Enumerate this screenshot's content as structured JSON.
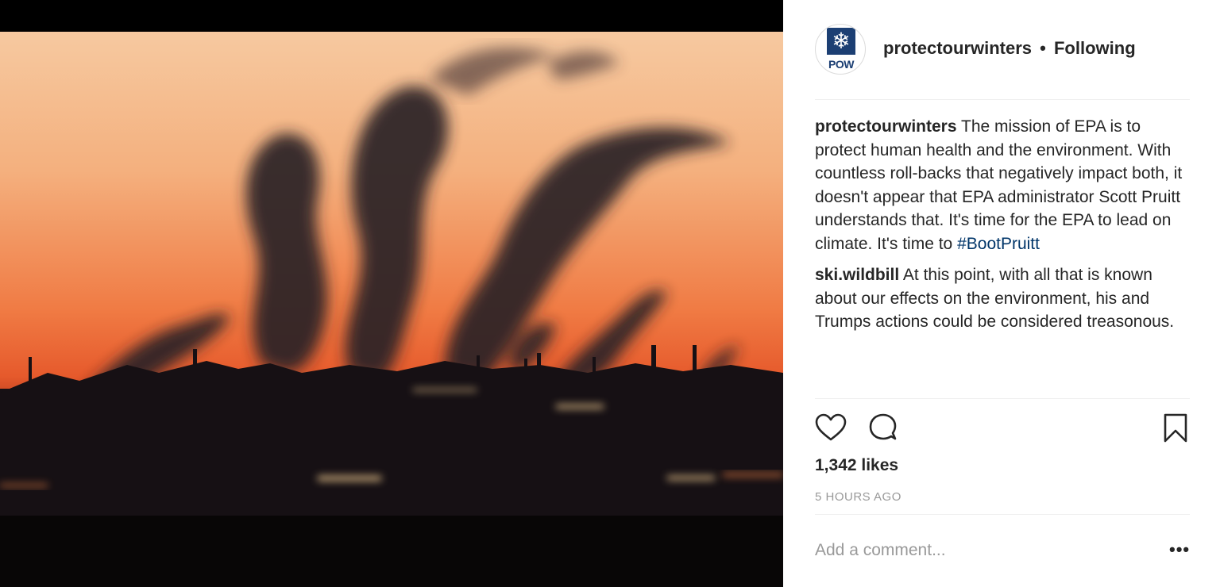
{
  "post": {
    "image_alt": "Smokestacks emitting plumes of smoke against an orange sunset sky",
    "author": {
      "username": "protectourwinters",
      "avatar_icon": "snowflake-icon",
      "avatar_text": "POW",
      "follow_separator": "•",
      "follow_status": "Following"
    },
    "comments": [
      {
        "username": "protectourwinters",
        "text": "The mission of EPA is to protect human health and the environment. With countless roll-backs that negatively impact both, it doesn't appear that EPA administrator Scott Pruitt understands that. It's time for the EPA to lead on climate. It's time to",
        "hashtag": "#BootPruitt"
      },
      {
        "username": "ski.wildbill",
        "text": "At this point, with all that is known about our effects on the environment, his and Trumps actions could be considered treasonous."
      }
    ],
    "actions": {
      "like_icon": "heart-icon",
      "comment_icon": "comment-bubble-icon",
      "save_icon": "bookmark-icon"
    },
    "likes": "1,342 likes",
    "time_ago": "5 HOURS AGO",
    "add_comment_placeholder": "Add a comment...",
    "more_label": "•••"
  },
  "colors": {
    "sky_top": "#f2b98f",
    "sky_mid": "#f07a3e",
    "sky_low": "#cf3f1c",
    "brand_navy": "#1c3f73",
    "hashtag": "#003569",
    "muted": "#999999"
  }
}
